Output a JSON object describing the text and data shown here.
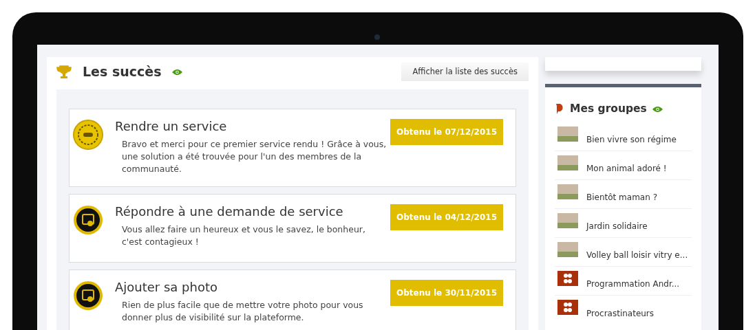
{
  "achievements_panel": {
    "title": "Les succès",
    "list_button": "Afficher la liste des succès",
    "achievements": [
      {
        "kind": "gold",
        "title": "Rendre un service",
        "description": "Bravo et merci pour ce premier service rendu ! Grâce à vous, une solution a été trouvée pour l'un des membres de la communauté.",
        "date": "Obtenu le 07/12/2015"
      },
      {
        "kind": "dark",
        "title": "Répondre à une demande de service",
        "description": "Vous allez faire un heureux et vous le savez, le bonheur, c'est contagieux !",
        "date": "Obtenu le 04/12/2015"
      },
      {
        "kind": "dark",
        "title": "Ajouter sa photo",
        "description": "Rien de plus facile que de mettre votre photo pour vous donner plus de visibilité sur la plateforme.",
        "date": "Obtenu le 30/11/2015"
      }
    ]
  },
  "groups_panel": {
    "title": "Mes groupes",
    "groups": [
      {
        "kind": "photo",
        "name": "Bien vivre son régime"
      },
      {
        "kind": "photo",
        "name": "Mon animal adoré !"
      },
      {
        "kind": "photo",
        "name": "Bientôt maman ?"
      },
      {
        "kind": "photo",
        "name": "Jardin solidaire"
      },
      {
        "kind": "photo",
        "name": "Volley ball loisir vitry e..."
      },
      {
        "kind": "logo",
        "name": "Programmation Andr..."
      },
      {
        "kind": "logo",
        "name": "Procrastinateurs"
      }
    ]
  }
}
